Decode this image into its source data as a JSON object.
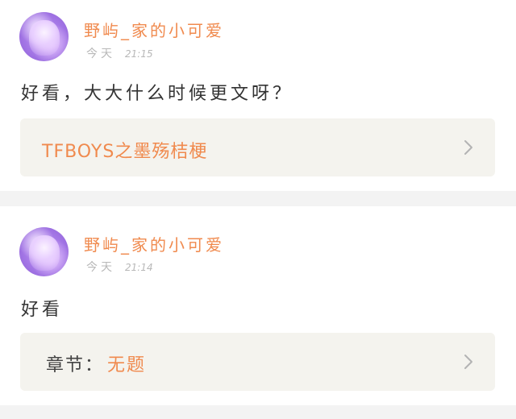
{
  "comments": [
    {
      "username": "野屿_家的小可爱",
      "day": "今天",
      "time": "21:15",
      "text": "好看，大大什么时候更文呀？",
      "reference": {
        "title": "TFBOYS之墨殇桔梗"
      }
    },
    {
      "username": "野屿_家的小可爱",
      "day": "今天",
      "time": "21:14",
      "text": "好看",
      "reference": {
        "chapter_label": "章节：",
        "chapter_value": "无题"
      }
    }
  ],
  "icons": {
    "chevron": "chevron-right-icon"
  },
  "colors": {
    "accent": "#f08a4e",
    "page_background": "#f3f3f3",
    "reference_background": "#f4f3ee",
    "meta_text": "#b8b8b8"
  }
}
